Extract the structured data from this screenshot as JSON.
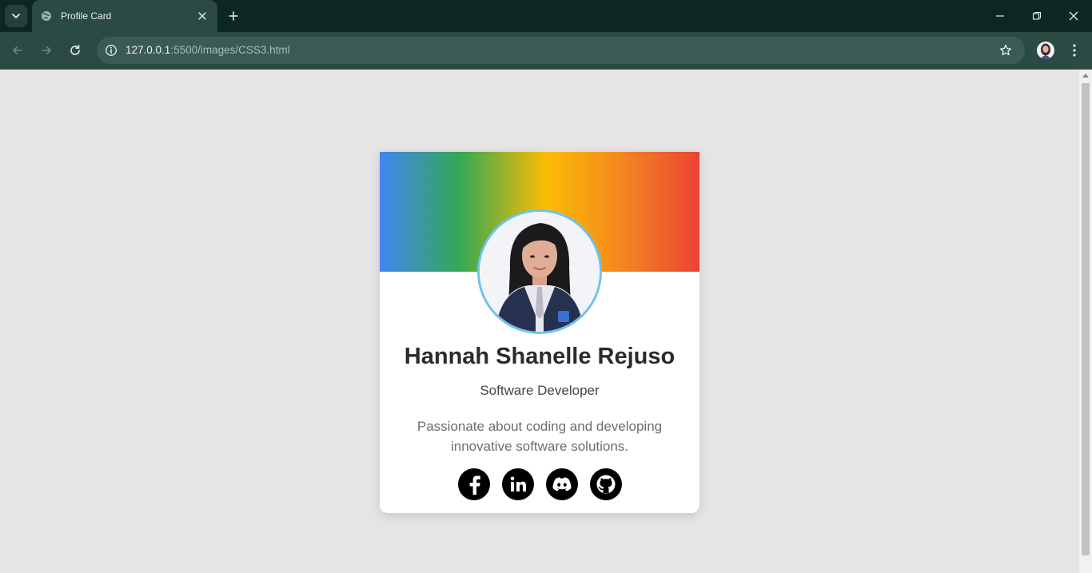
{
  "browser": {
    "tab": {
      "title": "Profile Card"
    },
    "url": {
      "host": "127.0.0.1",
      "rest": ":5500/images/CSS3.html"
    }
  },
  "profile": {
    "name": "Hannah Shanelle Rejuso",
    "role": "Software Developer",
    "bio": "Passionate about coding and developing innovative software solutions.",
    "socials": [
      {
        "icon": "facebook-icon"
      },
      {
        "icon": "linkedin-icon"
      },
      {
        "icon": "discord-icon"
      },
      {
        "icon": "github-icon"
      }
    ]
  },
  "colors": {
    "banner_gradient": [
      "#4285f4",
      "#34a853",
      "#fbbc05",
      "#f4891f",
      "#ea4335"
    ],
    "photo_border": "#6ec3ec",
    "page_background": "#e6e4e5"
  }
}
